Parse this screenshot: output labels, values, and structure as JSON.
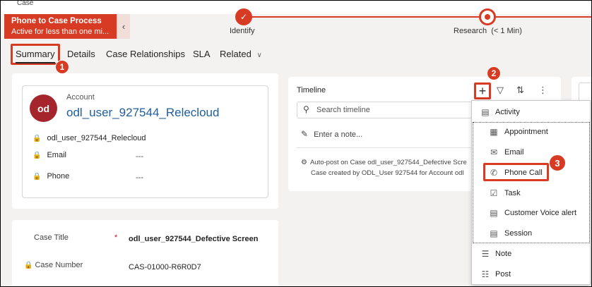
{
  "window_title_partial": "Case",
  "process": {
    "name": "Phone to Case Process",
    "status": "Active for less than one mi...",
    "stages": [
      {
        "label": "Identify",
        "state": "completed"
      },
      {
        "label": "Research",
        "duration": "(< 1 Min)",
        "state": "active"
      }
    ],
    "accent_color": "#d83b23"
  },
  "tabs": [
    {
      "label": "Summary",
      "selected": true
    },
    {
      "label": "Details"
    },
    {
      "label": "Case Relationships"
    },
    {
      "label": "SLA"
    },
    {
      "label": "Related"
    }
  ],
  "callouts": [
    "1",
    "2",
    "3"
  ],
  "account": {
    "section_label": "Account",
    "initials": "od",
    "name": "odl_user_927544_Relecloud",
    "fields": [
      {
        "label": "odl_user_927544_Relecloud",
        "value": ""
      },
      {
        "label": "Email",
        "value": "---"
      },
      {
        "label": "Phone",
        "value": "---"
      }
    ]
  },
  "case": {
    "title_label": "Case Title",
    "title_value": "odl_user_927544_Defective Screen",
    "required_mark": "*",
    "number_label": "Case Number",
    "number_value": "CAS-01000-R6R0D7"
  },
  "timeline": {
    "title": "Timeline",
    "add_icon": "+",
    "search_placeholder": "Search timeline",
    "note_placeholder": "Enter a note...",
    "post_line1": "Auto-post on Case odl_user_927544_Defective Scre",
    "post_line2": "Case created by ODL_User 927544 for Account odl"
  },
  "menu": {
    "items": [
      {
        "label": "Activity",
        "icon": "activity-icon"
      },
      {
        "label": "Appointment",
        "icon": "calendar-icon"
      },
      {
        "label": "Email",
        "icon": "mail-icon"
      },
      {
        "label": "Phone Call",
        "icon": "phone-icon"
      },
      {
        "label": "Task",
        "icon": "task-icon"
      },
      {
        "label": "Customer Voice alert",
        "icon": "alert-icon"
      },
      {
        "label": "Session",
        "icon": "session-icon"
      },
      {
        "label": "Note",
        "icon": "note-icon"
      },
      {
        "label": "Post",
        "icon": "post-icon"
      }
    ]
  }
}
